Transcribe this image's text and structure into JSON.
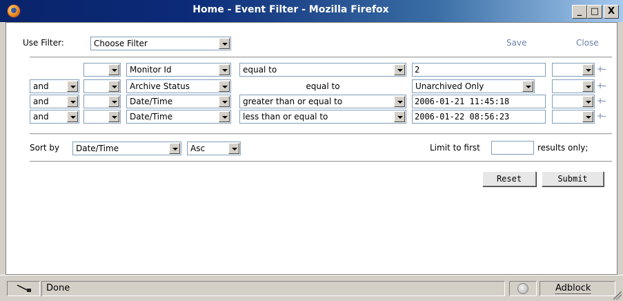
{
  "window": {
    "title": "Home - Event Filter - Mozilla Firefox",
    "minimize": "_",
    "maximize": "□",
    "close": "X"
  },
  "toolbar": {
    "use_filter_label": "Use Filter:",
    "use_filter_value": "Choose Filter",
    "save_label": "Save",
    "close_label": "Close"
  },
  "filter_rows": [
    {
      "conj": "",
      "paren_open": "",
      "field": "Monitor Id",
      "operator": "equal to",
      "value": "2",
      "paren_close": "",
      "plus": "+",
      "minus": "–"
    },
    {
      "conj": "and",
      "paren_open": "",
      "field": "Archive Status",
      "operator": "equal to",
      "value": "Unarchived Only",
      "paren_close": "",
      "plus": "+",
      "minus": "–"
    },
    {
      "conj": "and",
      "paren_open": "",
      "field": "Date/Time",
      "operator": "greater than or equal to",
      "value": "2006-01-21 11:45:18",
      "paren_close": "",
      "plus": "+",
      "minus": "–"
    },
    {
      "conj": "and",
      "paren_open": "",
      "field": "Date/Time",
      "operator": "less than or equal to",
      "value": "2006-01-22 08:56:23",
      "paren_close": "",
      "plus": "+",
      "minus": "–"
    }
  ],
  "sort": {
    "label": "Sort by",
    "field": "Date/Time",
    "direction": "Asc",
    "limit_label": "Limit to first",
    "limit_value": "",
    "limit_suffix": "results only;"
  },
  "actions": {
    "reset": "Reset",
    "submit": "Submit"
  },
  "status": {
    "text": "Done",
    "adblock": "Adblock"
  },
  "colors": {
    "link": "#6b7fa8",
    "titlebar": "#0a246a"
  }
}
